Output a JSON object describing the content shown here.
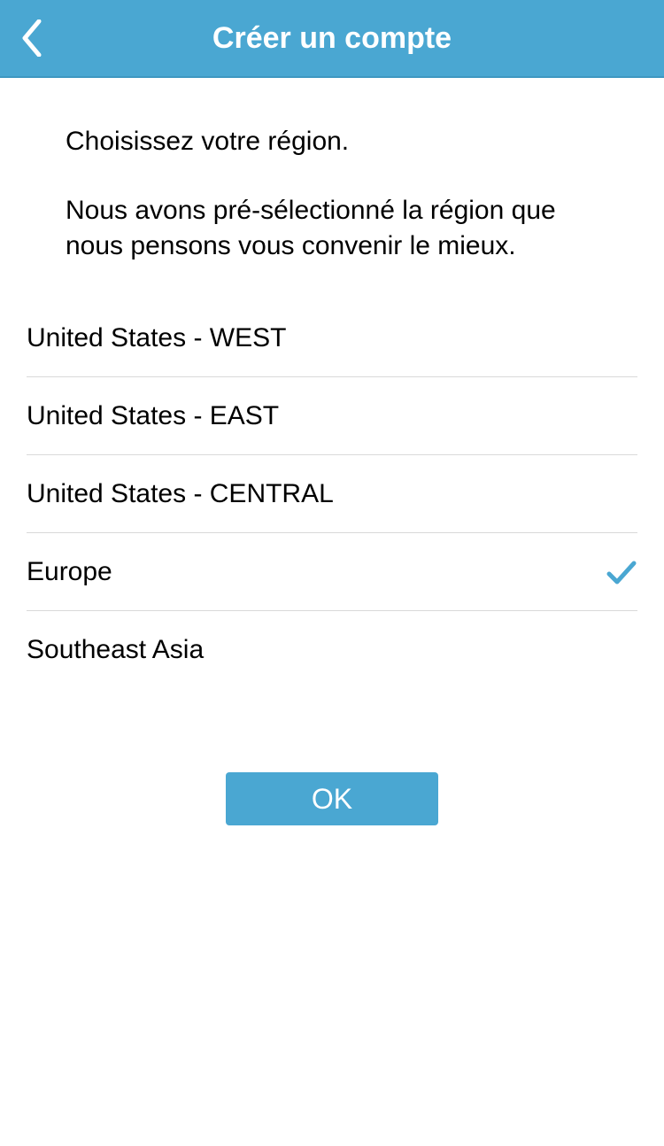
{
  "header": {
    "title": "Créer un compte"
  },
  "intro": {
    "line1": "Choisissez votre région.",
    "line2": "Nous avons pré-sélectionné la région que nous pensons vous convenir le mieux."
  },
  "regions": [
    {
      "label": "United States - WEST",
      "selected": false
    },
    {
      "label": "United States - EAST",
      "selected": false
    },
    {
      "label": "United States - CENTRAL",
      "selected": false
    },
    {
      "label": "Europe",
      "selected": true
    },
    {
      "label": "Southeast Asia",
      "selected": false
    }
  ],
  "footer": {
    "ok_label": "OK"
  }
}
